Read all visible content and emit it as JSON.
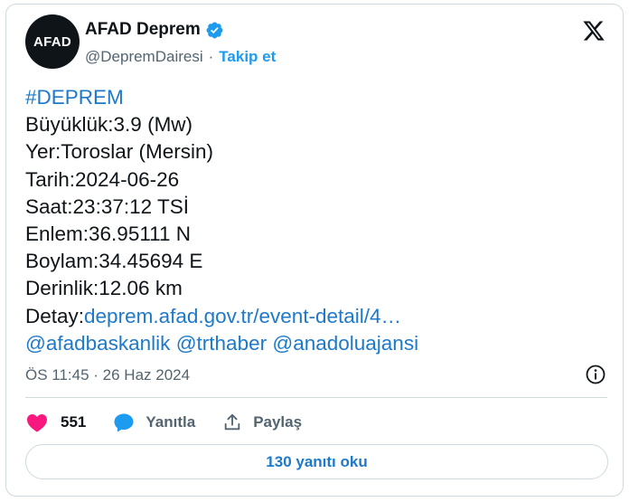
{
  "author": {
    "avatar_text": "AFAD",
    "name": "AFAD Deprem",
    "handle": "@DepremDairesi",
    "separator": "·",
    "follow_label": "Takip et"
  },
  "tweet": {
    "hashtag": "#DEPREM",
    "lines": [
      "Büyüklük:3.9 (Mw)",
      "Yer:Toroslar (Mersin)",
      "Tarih:2024-06-26",
      "Saat:23:37:12 TSİ",
      "Enlem:36.95111 N",
      "Boylam:34.45694 E",
      "Derinlik:12.06 km"
    ],
    "detail_label": "Detay:",
    "detail_link": "deprem.afad.gov.tr/event-detail/4…",
    "mentions": [
      "@afadbaskanlik",
      "@trthaber",
      "@anadoluajansi"
    ]
  },
  "meta": {
    "timestamp": "ÖS 11:45 · 26 Haz 2024"
  },
  "actions": {
    "likes": "551",
    "reply_label": "Yanıtla",
    "share_label": "Paylaş"
  },
  "replies_button": "130 yanıtı oku",
  "colors": {
    "accent": "#1d9bf0",
    "link": "#1d79c9",
    "like": "#f91880",
    "text": "#0f1419",
    "muted": "#536471",
    "border": "#cfd9de"
  }
}
